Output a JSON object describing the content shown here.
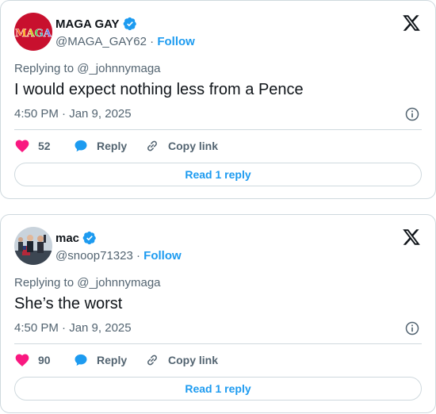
{
  "colors": {
    "accent": "#1d9bf0",
    "heart": "#f91880",
    "muted": "#536471",
    "text": "#0f1419"
  },
  "tweets": [
    {
      "display_name": "MAGA GAY",
      "handle": "@MAGA_GAY62",
      "separator": "·",
      "follow_label": "Follow",
      "avatar_text": "MAGA",
      "replying_label": "Replying to",
      "replying_to": "@_johnnymaga",
      "text": "I would expect nothing less from a Pence",
      "timestamp": "4:50 PM · Jan 9, 2025",
      "likes": "52",
      "reply_label": "Reply",
      "copy_link_label": "Copy link",
      "read_replies_label": "Read 1 reply"
    },
    {
      "display_name": "mac",
      "handle": "@snoop71323",
      "separator": "·",
      "follow_label": "Follow",
      "replying_label": "Replying to",
      "replying_to": "@_johnnymaga",
      "text": "She’s the worst",
      "timestamp": "4:50 PM · Jan 9, 2025",
      "likes": "90",
      "reply_label": "Reply",
      "copy_link_label": "Copy link",
      "read_replies_label": "Read 1 reply"
    }
  ]
}
